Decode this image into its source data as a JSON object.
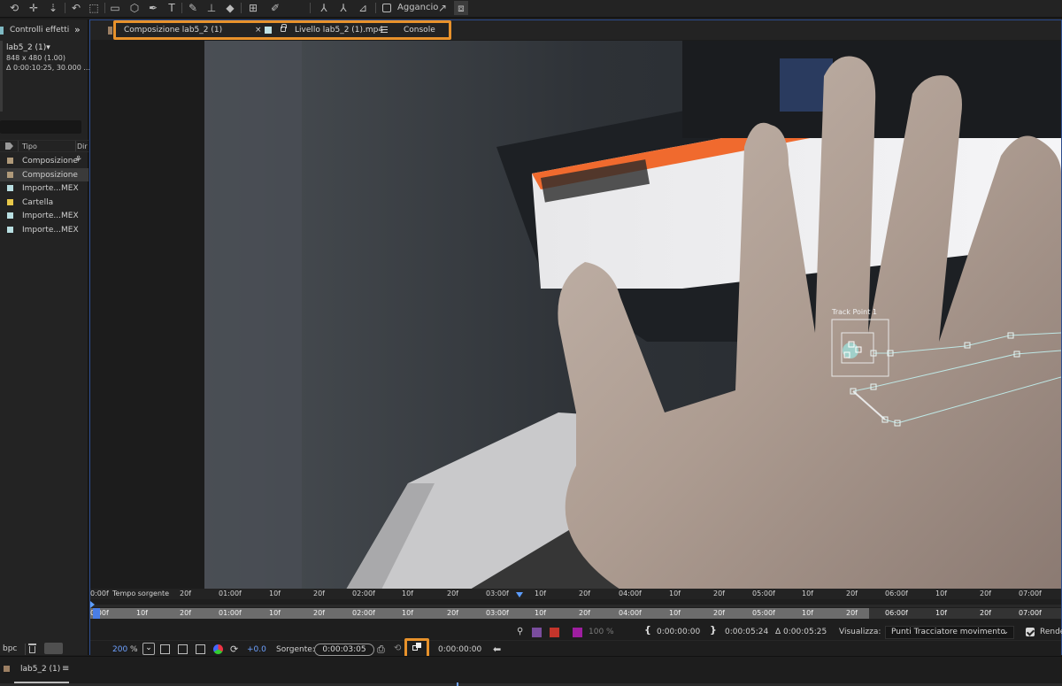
{
  "toolbar": {
    "icons": [
      "hand-rotate-icon",
      "anchor-move-icon",
      "pan-down-icon",
      "rotate-icon",
      "selection-marquee-icon",
      "rectangle-icon",
      "cube-icon",
      "pen-icon",
      "type-icon",
      "brush-icon",
      "stamp-icon",
      "eraser-icon",
      "roto-brush-icon",
      "puppet-pin-icon",
      "axis-local-icon",
      "axis-world-icon",
      "axis-view-icon",
      "snap-arrow-icon",
      "snap-frame-icon"
    ],
    "snap_label": "Aggancio"
  },
  "left_panel": {
    "tab_label": "Controlli effetti la",
    "comp_name": "lab5_2 (1)▾",
    "comp_size": "848 x 480 (1.00)",
    "comp_duration": "Δ 0:00:10:25, 30.000 ...",
    "col_type": "Tipo",
    "col_dir": "Dir",
    "items": [
      {
        "label": "Composizione",
        "color": "#b09a7a",
        "flow": true
      },
      {
        "label": "Composizione",
        "color": "#b09a7a",
        "flow": false
      },
      {
        "label": "Importe...MEX",
        "color": "#b9dfe2",
        "flow": false
      },
      {
        "label": "Cartella",
        "color": "#e8c84a",
        "flow": false
      },
      {
        "label": "Importe...MEX",
        "color": "#b9dfe2",
        "flow": false
      },
      {
        "label": "Importe...MEX",
        "color": "#b9dfe2",
        "flow": false
      }
    ],
    "bpc_label": "bpc"
  },
  "viewer": {
    "tab_comp": "Composizione lab5_2 (1)",
    "tab_comp_close": "×",
    "tab_layer": "Livello lab5_2 (1).mp4",
    "tab_console": "Console",
    "track_point_label": "Track Point 1",
    "ruler_top": [
      "0:00f",
      "Tempo sorgente",
      "20f",
      "01:00f",
      "10f",
      "20f",
      "02:00f",
      "10f",
      "20f",
      "03:00f",
      "10f",
      "20f",
      "04:00f",
      "10f",
      "20f",
      "05:00f",
      "10f",
      "20f",
      "06:00f",
      "10f",
      "20f",
      "07:00f"
    ],
    "ruler_bottom": [
      "0:00f",
      "10f",
      "20f",
      "01:00f",
      "10f",
      "20f",
      "02:00f",
      "10f",
      "20f",
      "03:00f",
      "10f",
      "20f",
      "04:00f",
      "10f",
      "20f",
      "05:00f",
      "10f",
      "20f",
      "06:00f",
      "10f",
      "20f",
      "07:00f"
    ],
    "opacity": "100 %",
    "in_point": "0:00:00:00",
    "out_point": "0:00:05:24",
    "duration": "Δ 0:00:05:25",
    "view_label": "Visualizza:",
    "view_value": "Punti Tracciatore movimento",
    "render_label": "Rende",
    "zoom": "200",
    "zoom_unit": "%",
    "exposure": "+0.0",
    "source_label": "Sorgente:",
    "source_time": "0:00:03:05",
    "current_time": "0:00:00:00"
  },
  "bottom": {
    "timeline_tab": "lab5_2 (1)",
    "menu_icon": "≡"
  }
}
